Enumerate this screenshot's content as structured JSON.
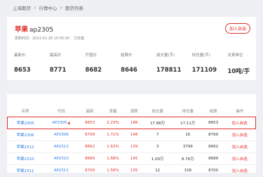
{
  "breadcrumb": [
    "上海期货",
    "行情中心",
    "期货列表"
  ],
  "header": {
    "name": "苹果",
    "code": "ap2305",
    "time_label": "更新时间：2023-01-26 15:00:00",
    "status": "已收盘",
    "add_button": "加入自选"
  },
  "stats": [
    {
      "label": "最新价",
      "value": "8653"
    },
    {
      "label": "最高价",
      "value": "8771"
    },
    {
      "label": "开盘价",
      "value": "8682"
    },
    {
      "label": "结算价",
      "value": "8646"
    },
    {
      "label": "成交量(手)",
      "value": "178811"
    },
    {
      "label": "持仓量(手)",
      "value": "171109"
    },
    {
      "label": "交易单位",
      "value": "10吨/手"
    }
  ],
  "table": {
    "headers": [
      "名称",
      "代码",
      "最新",
      "涨幅",
      "涨跌",
      "成交量",
      "持仓量",
      "结算",
      "操作"
    ],
    "rows": [
      {
        "name": "苹果2305",
        "code": "AP2305",
        "last": "8653",
        "change_pct": "2.23%",
        "change": "188",
        "volume": "17.88万",
        "oi": "17.11万",
        "settle": "8653",
        "action": "加入自选"
      },
      {
        "name": "苹果2306",
        "code": "AP2306",
        "last": "8799",
        "change_pct": "1.71%",
        "change": "148",
        "volume": "7",
        "oi": "16",
        "settle": "8799",
        "action": "加入自选"
      },
      {
        "name": "苹果2312",
        "code": "AP2312",
        "last": "8662",
        "change_pct": "1.63%",
        "change": "139",
        "volume": "3",
        "oi": "3799",
        "settle": "8662",
        "action": "加入自选"
      },
      {
        "name": "苹果2310",
        "code": "AP2310",
        "last": "8689",
        "change_pct": "1.68%",
        "change": "145",
        "volume": "1.09万",
        "oi": "8.76万",
        "settle": "8689",
        "action": "加入自选"
      },
      {
        "name": "苹果2311",
        "code": "AP2311",
        "last": "8700",
        "change_pct": "1.58%",
        "change": "135",
        "volume": "12",
        "oi": "158",
        "settle": "8700",
        "action": "加入自选"
      }
    ]
  }
}
